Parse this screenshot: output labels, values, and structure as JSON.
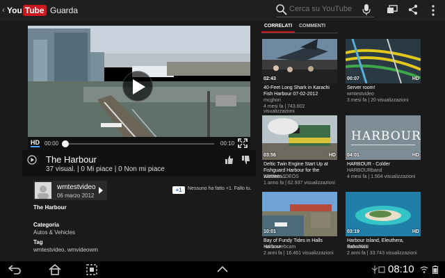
{
  "app": {
    "back_glyph": "‹",
    "logo_you": "You",
    "logo_tube": "Tube",
    "title": "Guarda"
  },
  "toolbar": {
    "search_placeholder": "Cerca su YouTube",
    "icons": [
      "search-icon",
      "mic-icon",
      "cast-icon",
      "share-icon",
      "more-icon"
    ]
  },
  "player": {
    "hd_label": "HD",
    "time_current": "00:00",
    "time_total": "00:10",
    "progress": 0
  },
  "video": {
    "title": "The Harbour",
    "stats": "37 visual. | 0 Mi piace | 0 Non mi piace"
  },
  "channel": {
    "name": "wmtestvideo",
    "date": "06 marzo 2012"
  },
  "plusone": {
    "label": "+1",
    "text": "Nessuno ha fatto +1. Fallo tu."
  },
  "description": {
    "title": "The Harbour",
    "category_label": "Categoria",
    "category_value": "Autos & Vehicles",
    "tag_label": "Tag",
    "tag_value": "wmtestvideo, wmvideowm"
  },
  "tabs": [
    {
      "label": "CORRELATI",
      "active": true
    },
    {
      "label": "COMMENTI",
      "active": false
    }
  ],
  "related": [
    {
      "duration": "02:43",
      "hd": "",
      "title": "40-Feet Long Shark in Karachi Fish Harbour 07-02-2012",
      "channel": "mcghori",
      "meta": "4 mesi fa | 743.602 visualizzazioni"
    },
    {
      "duration": "00:07",
      "hd": "HD",
      "title": "Server room!",
      "channel": "wmtestvideo",
      "meta": "3 mesi fa | 20 visualizzazioni"
    },
    {
      "duration": "03:56",
      "hd": "HD",
      "title": "Deltic Twin Engine Start Up at Fishguard Harbour for the Western...",
      "channel": "KBRAILVIDEOS",
      "meta": "1 anno fa | 62.937 visualizzazioni"
    },
    {
      "duration": "04:01",
      "hd": "HD",
      "title": "HARBOUR - Colder",
      "channel": "HARBOURband",
      "meta": "4 mesi fa | 1.504 visualizzazioni",
      "thumb_text": "HARBOUR"
    },
    {
      "duration": "10:01",
      "hd": "",
      "title": "Bay of Fundy Tides in Halls Harbour",
      "channel": "halifaxwebcam",
      "meta": "2 anni fa | 16.461 visualizzazioni"
    },
    {
      "duration": "03:19",
      "hd": "HD",
      "title": "Harbour Island, Eleuthera, Bahamas",
      "channel": "thore2009",
      "meta": "2 anni fa | 33.743 visualizzazioni"
    }
  ],
  "statusbar": {
    "clock": "08:10"
  }
}
